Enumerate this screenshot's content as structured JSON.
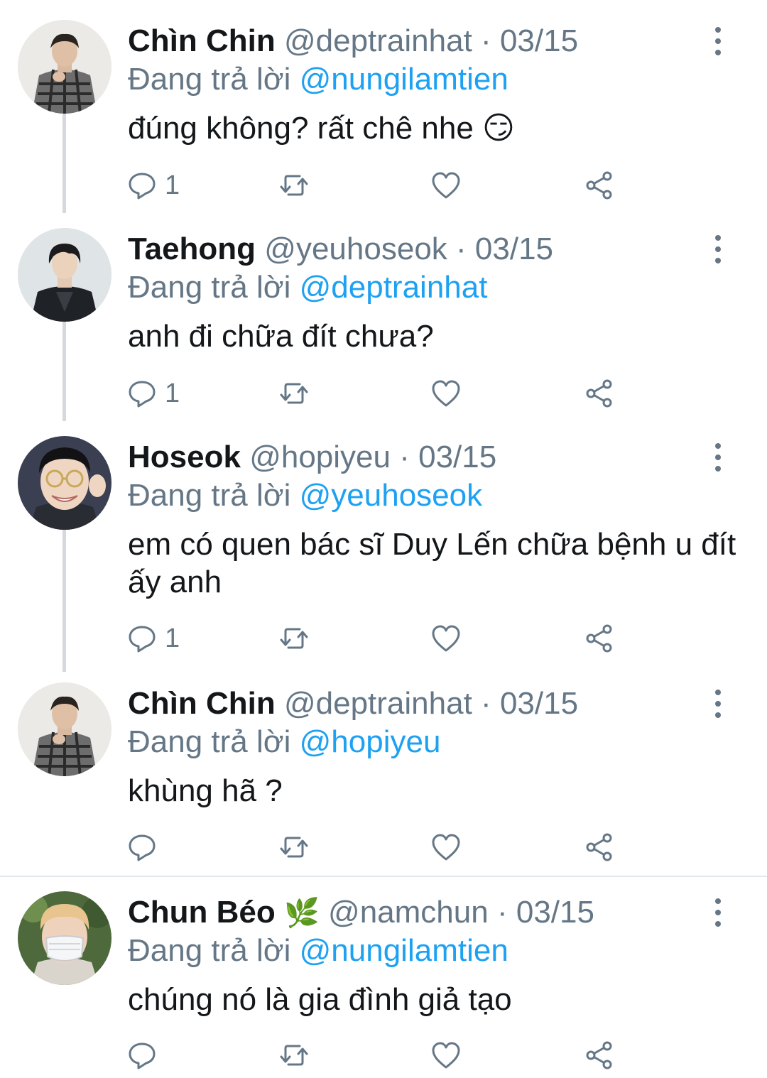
{
  "tweets": [
    {
      "name": "Chìn Chin",
      "handle": "@deptrainhat",
      "date": "03/15",
      "reply_prefix": "Đang trả lời",
      "reply_to": "@nungilamtien",
      "text": "đúng không? rất chê nhe 😏",
      "reply_count": "1",
      "avatar_icon": "avatar-plaid-coat"
    },
    {
      "name": "Taehong",
      "handle": "@yeuhoseok",
      "date": "03/15",
      "reply_prefix": "Đang trả lời",
      "reply_to": "@deptrainhat",
      "text": "anh đi chữa đít chưa?",
      "reply_count": "1",
      "avatar_icon": "avatar-dark-coat"
    },
    {
      "name": "Hoseok",
      "handle": "@hopiyeu",
      "date": "03/15",
      "reply_prefix": "Đang trả lời",
      "reply_to": "@yeuhoseok",
      "text": "em có quen bác sĩ Duy Lến chữa bệnh u đít ấy anh",
      "reply_count": "1",
      "avatar_icon": "avatar-glasses-smile"
    },
    {
      "name": "Chìn Chin",
      "handle": "@deptrainhat",
      "date": "03/15",
      "reply_prefix": "Đang trả lời",
      "reply_to": "@hopiyeu",
      "text": "khùng hã ?",
      "reply_count": "",
      "avatar_icon": "avatar-plaid-coat"
    },
    {
      "name": "Chun Béo",
      "name_emoji": "🌿",
      "handle": "@namchun",
      "date": "03/15",
      "reply_prefix": "Đang trả lời",
      "reply_to": "@nungilamtien",
      "text": "chúng nó là gia đình giả tạo",
      "reply_count": "",
      "avatar_icon": "avatar-face-mask"
    }
  ],
  "separator": "·",
  "colors": {
    "link": "#1da1f2",
    "meta": "#657786",
    "text": "#14171a",
    "thread_line": "#d5d8dc"
  },
  "icons": [
    "reply-icon",
    "retweet-icon",
    "like-icon",
    "share-icon",
    "more-options-icon"
  ]
}
